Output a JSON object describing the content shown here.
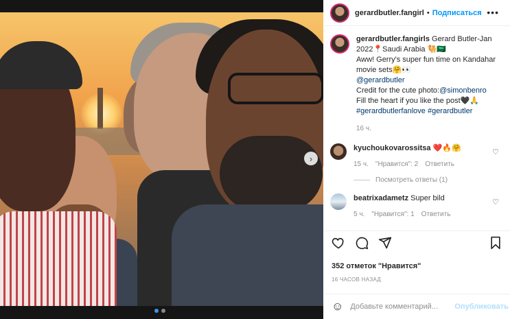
{
  "post": {
    "username": "gerardbutler.fangirl",
    "follow_label": "Подписаться",
    "more_label": "•••",
    "next_label": "›"
  },
  "caption": {
    "username": "gerardbutler.fangirls",
    "line1": " Gerard Butler-Jan 2022📍Saudi Arabia 🐫🇸🇦",
    "line2": "Aww! Gerry's super fun time on Kandahar movie sets🤗👀",
    "mention1": "@gerardbutler",
    "credit_prefix": "Credit for the cute photo:",
    "mention2": "@simonbenro",
    "line4": "Fill the heart if you like the post🖤🙏",
    "hashtags": "#gerardbutlerfanlove #gerardbutler",
    "time": "16 ч."
  },
  "comments": [
    {
      "username": "kyuchoukovarossitsa",
      "text": " ❤️🔥🤗",
      "time": "15 ч.",
      "likes": "\"Нравится\": 2",
      "reply": "Ответить",
      "view_replies": "Посмотреть ответы (1)"
    },
    {
      "username": "beatrixadametz",
      "text": " Super bild",
      "time": "5 ч.",
      "likes": "\"Нравится\": 1",
      "reply": "Ответить"
    }
  ],
  "actions": {
    "like_icon": "heart-icon",
    "comment_icon": "comment-icon",
    "share_icon": "share-icon",
    "save_icon": "bookmark-icon"
  },
  "likes_text": "352 отметок \"Нравится\"",
  "posted_time": "16 ЧАСОВ НАЗАД",
  "add_comment": {
    "placeholder": "Добавьте комментарий...",
    "publish_label": "Опубликовать"
  },
  "carousel": {
    "current": 1,
    "total": 2
  },
  "colors": {
    "accent": "#0095f6",
    "link": "#00376b",
    "publish_disabled": "#b2dffc"
  }
}
